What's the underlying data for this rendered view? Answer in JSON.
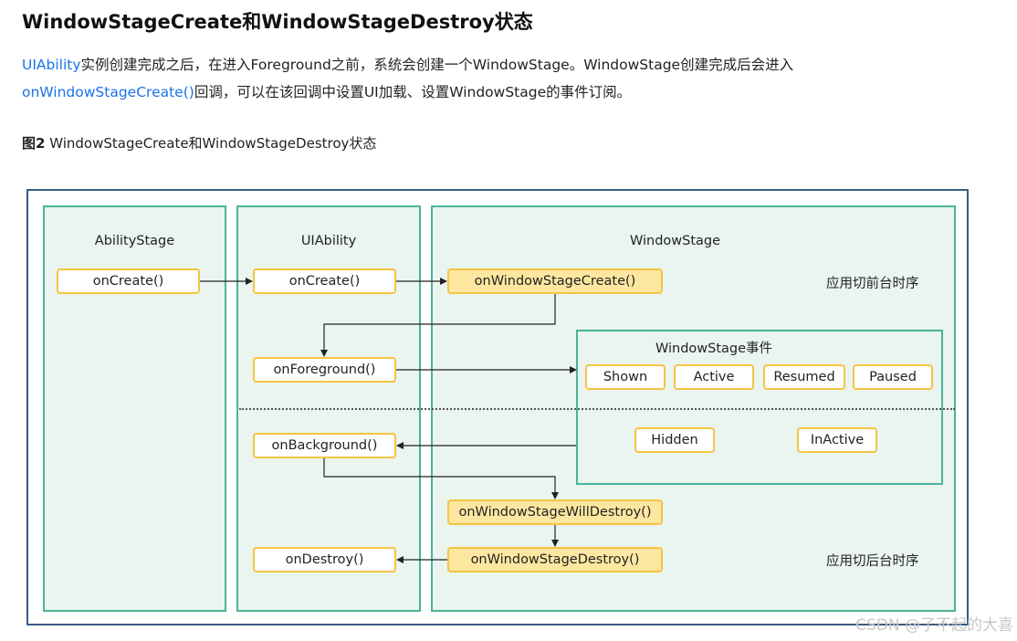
{
  "heading": "WindowStageCreate和WindowStageDestroy状态",
  "paragraph": {
    "link1": "UIAbility",
    "text1": "实例创建完成之后，在进入Foreground之前，系统会创建一个WindowStage。WindowStage创建完成后会进入",
    "link2": "onWindowStageCreate()",
    "text2": "回调，可以在该回调中设置UI加载、设置WindowStage的事件订阅。"
  },
  "caption": {
    "label": "图2",
    "text": "WindowStageCreate和WindowStageDestroy状态"
  },
  "diagram": {
    "columns": {
      "ability_stage": "AbilityStage",
      "uiability": "UIAbility",
      "window_stage": "WindowStage"
    },
    "ability_stage_on_create": "onCreate()",
    "uiability": {
      "on_create": "onCreate()",
      "on_foreground": "onForeground()",
      "on_background": "onBackground()",
      "on_destroy": "onDestroy()"
    },
    "window_stage": {
      "on_create": "onWindowStageCreate()",
      "on_will_destroy": "onWindowStageWillDestroy()",
      "on_destroy": "onWindowStageDestroy()"
    },
    "events": {
      "title": "WindowStage事件",
      "shown": "Shown",
      "active": "Active",
      "resumed": "Resumed",
      "paused": "Paused",
      "hidden": "Hidden",
      "inactive": "InActive"
    },
    "notes": {
      "foreground_sequence": "应用切前台时序",
      "background_sequence": "应用切后台时序"
    },
    "colors": {
      "frame_border": "#3b5b83",
      "column_border": "#4bb39b",
      "column_fill": "#eaf5ef",
      "box_border": "#f6c343",
      "box_highlight": "#fde7a0",
      "link": "#1a73e8"
    }
  },
  "watermark": "CSDN @了不起的大喜"
}
